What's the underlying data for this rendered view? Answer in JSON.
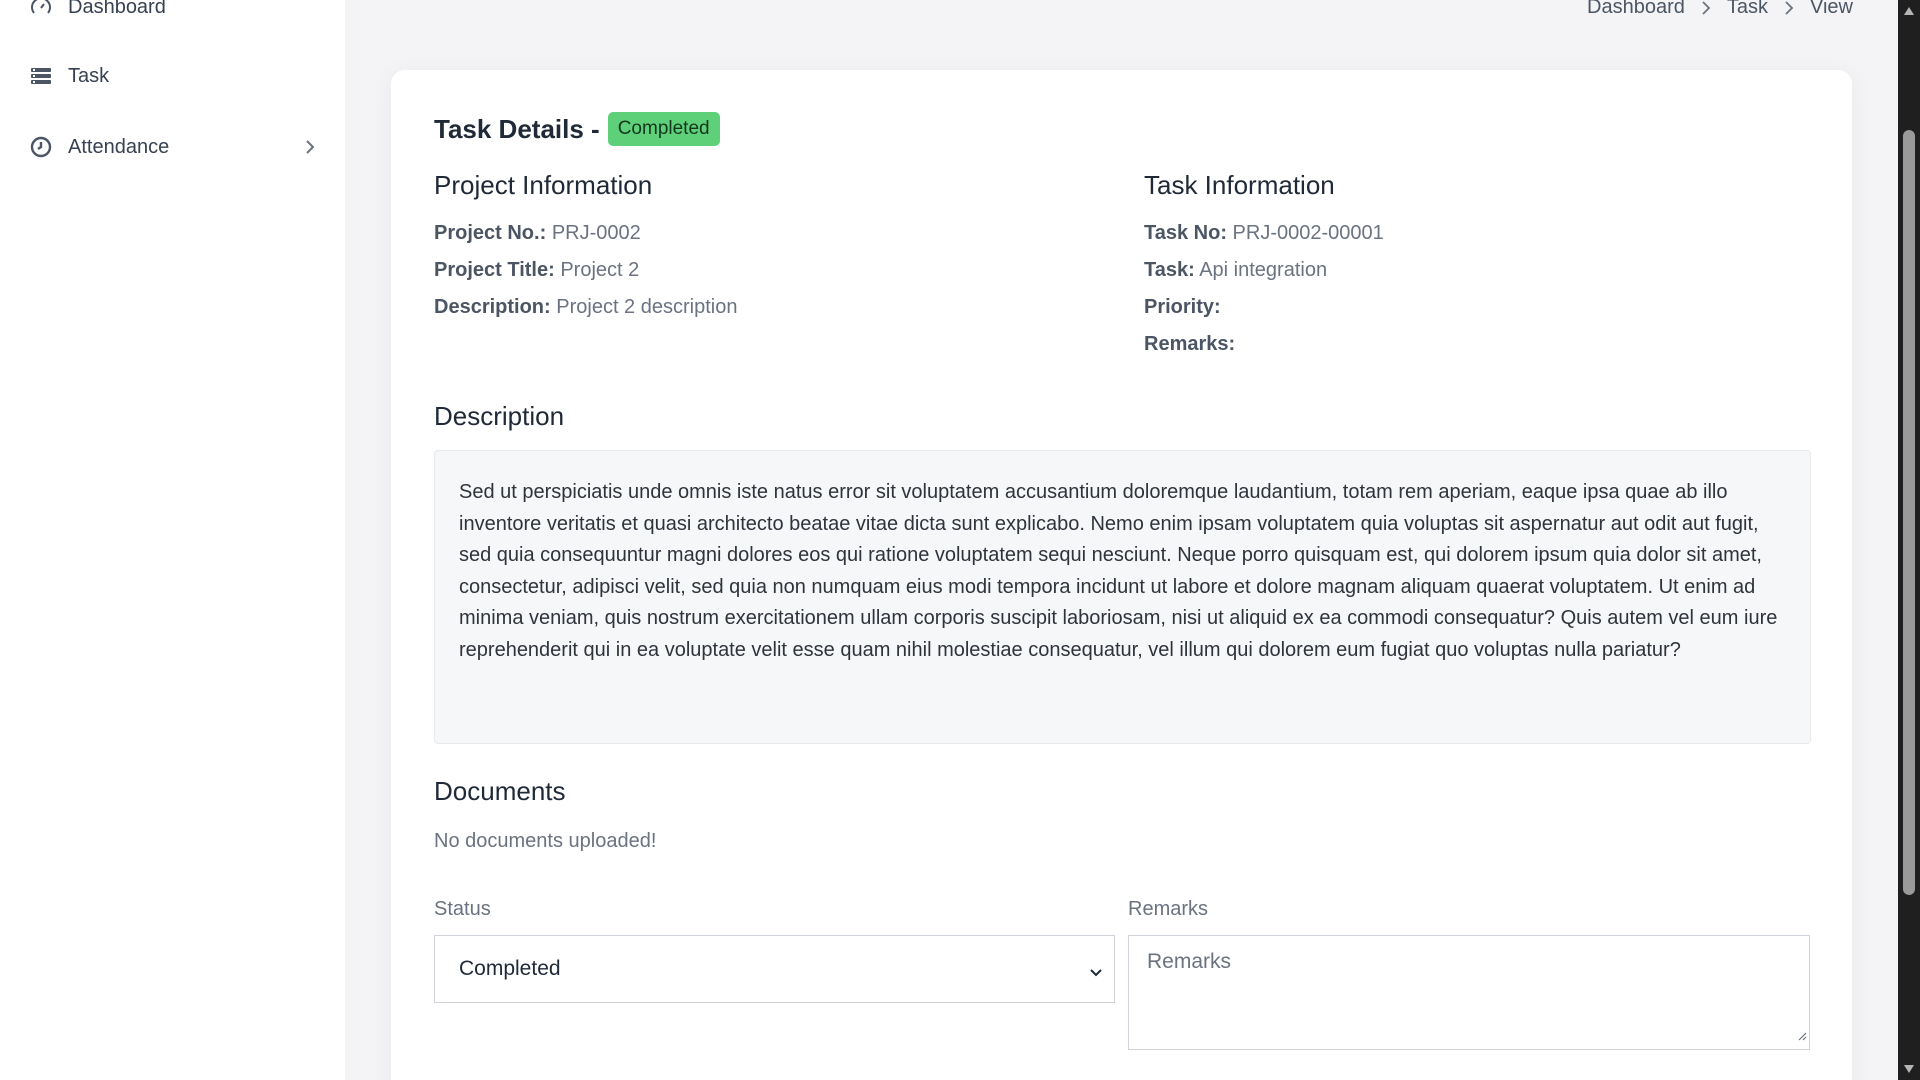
{
  "sidebar": {
    "items": [
      {
        "label": "Dashboard",
        "icon": "gauge-icon"
      },
      {
        "label": "Task",
        "icon": "list-icon"
      },
      {
        "label": "Attendance",
        "icon": "clock-icon"
      }
    ]
  },
  "breadcrumb": [
    "Dashboard",
    "Task",
    "View"
  ],
  "task": {
    "title": "Task Details -",
    "status_badge": "Completed",
    "badge_color": "#5fd07a"
  },
  "project_info": {
    "heading": "Project Information",
    "project_no_label": "Project No.:",
    "project_no": "PRJ-0002",
    "project_title_label": "Project Title:",
    "project_title": "Project 2",
    "description_label": "Description:",
    "description": "Project 2 description"
  },
  "task_info": {
    "heading": "Task Information",
    "task_no_label": "Task No:",
    "task_no": "PRJ-0002-00001",
    "task_label": "Task:",
    "task": "Api integration",
    "priority_label": "Priority:",
    "priority": "",
    "remarks_label": "Remarks:",
    "remarks": ""
  },
  "description_section": {
    "heading": "Description",
    "text": "Sed ut perspiciatis unde omnis iste natus error sit voluptatem accusantium doloremque laudantium, totam rem aperiam, eaque ipsa quae ab illo inventore veritatis et quasi architecto beatae vitae dicta sunt explicabo. Nemo enim ipsam voluptatem quia voluptas sit aspernatur aut odit aut fugit, sed quia consequuntur magni dolores eos qui ratione voluptatem sequi nesciunt. Neque porro quisquam est, qui dolorem ipsum quia dolor sit amet, consectetur, adipisci velit, sed quia non numquam eius modi tempora incidunt ut labore et dolore magnam aliquam quaerat voluptatem. Ut enim ad minima veniam, quis nostrum exercitationem ullam corporis suscipit laboriosam, nisi ut aliquid ex ea commodi consequatur? Quis autem vel eum iure reprehenderit qui in ea voluptate velit esse quam nihil molestiae consequatur, vel illum qui dolorem eum fugiat quo voluptas nulla pariatur?"
  },
  "documents": {
    "heading": "Documents",
    "empty_text": "No documents uploaded!"
  },
  "form": {
    "status_label": "Status",
    "status_value": "Completed",
    "remarks_label": "Remarks",
    "remarks_placeholder": "Remarks"
  }
}
